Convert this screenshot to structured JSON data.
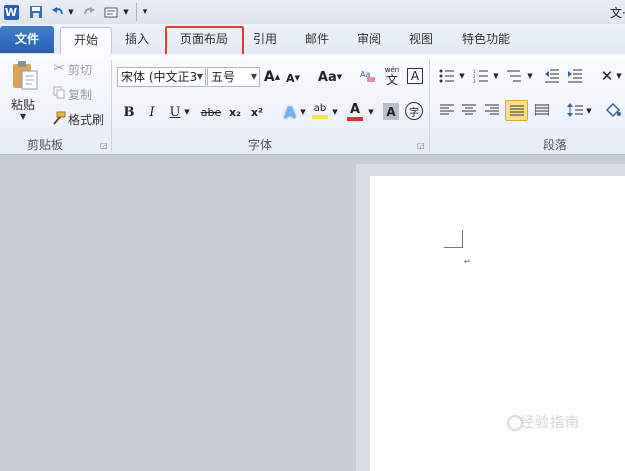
{
  "quick_access": {
    "app_icon_letter": "W",
    "title_fragment": "文·"
  },
  "tabs": {
    "file": "文件",
    "home": "开始",
    "insert": "插入",
    "page_layout": "页面布局",
    "references": "引用",
    "mailings": "邮件",
    "review": "审阅",
    "view": "视图",
    "special": "特色功能"
  },
  "clipboard": {
    "paste_label": "粘贴",
    "cut_label": "剪切",
    "copy_label": "复制",
    "format_painter_label": "格式刷",
    "group_label": "剪贴板"
  },
  "font": {
    "font_name": "宋体 (中文正3",
    "font_size": "五号",
    "group_label": "字体",
    "grow_glyph": "A",
    "shrink_glyph": "A",
    "case_glyph": "Aa",
    "bold": "B",
    "italic": "I",
    "underline": "U",
    "strike": "abe",
    "subscript": "x₂",
    "superscript": "x²",
    "highlight_glyph": "ab",
    "color_glyph": "A",
    "shade_glyph": "A",
    "enclose_glyph": "字",
    "phonetic_glyph": "wén",
    "phonetic_char": "文",
    "border_glyph": "A"
  },
  "paragraph": {
    "group_label": "段落"
  },
  "watermark": "经验指南",
  "colors": {
    "accent_file_tab": "#2a5fae",
    "highlight_box": "#e0403a",
    "font_color_bar": "#e03030",
    "highlight_bar": "#f7e53b"
  }
}
